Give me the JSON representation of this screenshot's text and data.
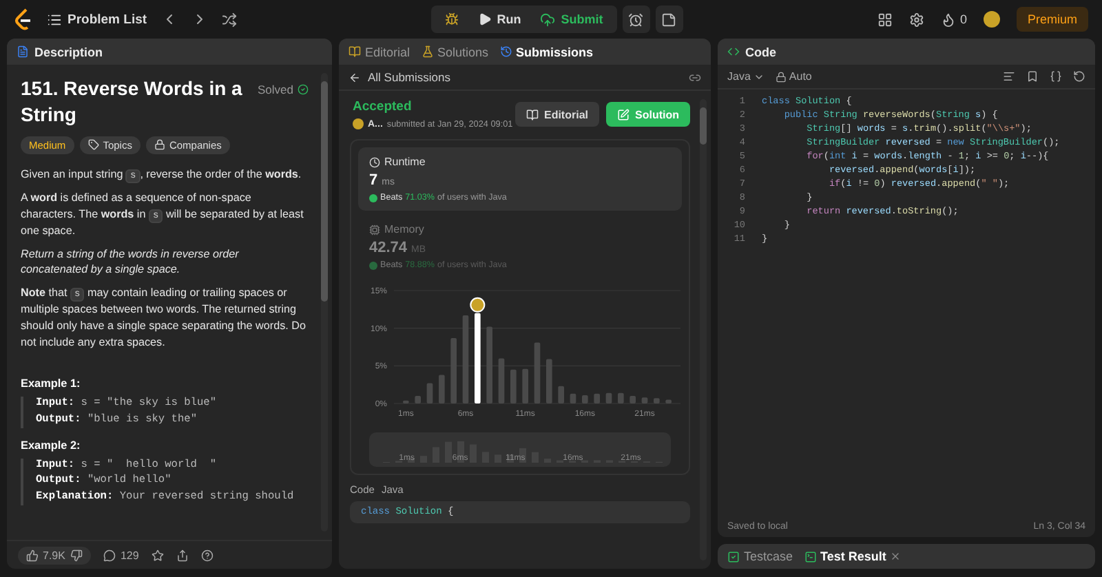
{
  "top_bar": {
    "problem_list": "Problem List",
    "run": "Run",
    "submit": "Submit",
    "streak": "0",
    "premium": "Premium"
  },
  "description_panel": {
    "tab": "Description",
    "title": "151. Reverse Words in a String",
    "status": "Solved",
    "tags": [
      {
        "label": "Medium",
        "kind": "difficulty"
      },
      {
        "label": "Topics",
        "kind": "topics"
      },
      {
        "label": "Companies",
        "kind": "companies"
      }
    ],
    "paragraphs": [
      [
        {
          "text": "Given an input string ",
          "kind": "text"
        },
        {
          "text": "s",
          "kind": "code"
        },
        {
          "text": ", reverse the order of the **words**.",
          "kind": "text"
        }
      ],
      [
        {
          "text": "A **word** is defined as a sequence of non-space characters. The **words** in ",
          "kind": "text"
        },
        {
          "text": "s",
          "kind": "code"
        },
        {
          "text": " will be separated by at least one space.",
          "kind": "text"
        }
      ],
      [
        {
          "text": "*Return* *a string of the words in reverse order concatenated by a single space.*",
          "kind": "text"
        }
      ],
      [
        {
          "text": "**Note** that ",
          "kind": "text"
        },
        {
          "text": "s",
          "kind": "code"
        },
        {
          "text": " may contain leading or trailing spaces or multiple spaces between two words. The returned string should only have a single space separating the words. Do not include any extra spaces.",
          "kind": "text"
        }
      ]
    ],
    "examples": [
      {
        "title": "Example 1:",
        "lines": [
          {
            "label": "Input:",
            "value": "s = \"the sky is blue\""
          },
          {
            "label": "Output:",
            "value": "\"blue is sky the\""
          }
        ]
      },
      {
        "title": "Example 2:",
        "lines": [
          {
            "label": "Input:",
            "value": "s = \"  hello world  \""
          },
          {
            "label": "Output:",
            "value": "\"world hello\""
          },
          {
            "label": "Explanation:",
            "value": "Your reversed string should"
          }
        ]
      }
    ],
    "likes": "7.9K",
    "comments": "129"
  },
  "submissions_panel": {
    "tabs": [
      {
        "label": "Editorial",
        "selected": false
      },
      {
        "label": "Solutions",
        "selected": false
      },
      {
        "label": "Submissions",
        "selected": true
      }
    ],
    "back_label": "All Submissions",
    "status": "Accepted",
    "user": "A...",
    "submitted": "submitted at Jan 29, 2024 09:01",
    "buttons": [
      {
        "label": "Editorial",
        "kind": "secondary"
      },
      {
        "label": "Solution",
        "kind": "primary"
      }
    ],
    "metrics": [
      {
        "kind": "runtime",
        "title": "Runtime",
        "value": "7",
        "unit": "ms",
        "beats_label": "Beats",
        "beats": "71.03%",
        "beats_suffix": "of users with Java",
        "selected": true
      },
      {
        "kind": "memory",
        "title": "Memory",
        "value": "42.74",
        "unit": "MB",
        "beats_label": "Beats",
        "beats": "78.88%",
        "beats_suffix": "of users with Java",
        "selected": false
      }
    ],
    "chart_data": {
      "type": "bar",
      "x": [
        1,
        2,
        3,
        4,
        5,
        6,
        7,
        8,
        9,
        10,
        11,
        12,
        13,
        14,
        15,
        16,
        17,
        18,
        19,
        20,
        21,
        22,
        23
      ],
      "series": [
        {
          "color": "#4a4a4a",
          "values": [
            0.4,
            1.0,
            2.7,
            3.8,
            8.7,
            11.7,
            null,
            10.2,
            6.0,
            4.5,
            4.6,
            8.1,
            5.9,
            2.3,
            1.3,
            1.1,
            1.3,
            1.4,
            1.4,
            1.0,
            0.8,
            0.7,
            0.5
          ]
        },
        {
          "color": "#ffffff",
          "values": [
            null,
            null,
            null,
            null,
            null,
            null,
            12.0,
            null,
            null,
            null,
            null,
            null,
            null,
            null,
            null,
            null,
            null,
            null,
            null,
            null,
            null,
            null,
            null
          ]
        }
      ],
      "xlim": [
        0,
        24
      ],
      "ylim": [
        0,
        15
      ],
      "xticks": [
        {
          "value": 1,
          "label": "1ms"
        },
        {
          "value": 6,
          "label": "6ms"
        },
        {
          "value": 11,
          "label": "11ms"
        },
        {
          "value": 16,
          "label": "16ms"
        },
        {
          "value": 21,
          "label": "21ms"
        }
      ],
      "yticks": [
        {
          "value": 0,
          "label": "0%"
        },
        {
          "value": 5,
          "label": "5%"
        },
        {
          "value": 10,
          "label": "10%"
        },
        {
          "value": 15,
          "label": "15%"
        }
      ]
    },
    "navigator": {
      "labels": [
        "1ms",
        "6ms",
        "11ms",
        "16ms",
        "21ms"
      ]
    },
    "code_label": "Code",
    "code_language": "Java",
    "code_preview": [
      {
        "text": "class ",
        "kind": "kw"
      },
      {
        "text": "Solution ",
        "kind": "type"
      },
      {
        "text": "{",
        "kind": "plain"
      }
    ]
  },
  "code_panel": {
    "title": "Code",
    "language": "Java",
    "mode": "Auto",
    "lines": [
      {
        "n": "1",
        "tokens": [
          {
            "text": "class ",
            "kind": "kw"
          },
          {
            "text": "Solution ",
            "kind": "type"
          },
          {
            "text": "{",
            "kind": "plain"
          }
        ]
      },
      {
        "n": "2",
        "tokens": [
          {
            "text": "    public ",
            "kind": "kw"
          },
          {
            "text": "String ",
            "kind": "type"
          },
          {
            "text": "reverseWords",
            "kind": "fn"
          },
          {
            "text": "(",
            "kind": "plain"
          },
          {
            "text": "String ",
            "kind": "type"
          },
          {
            "text": "s",
            "kind": "var"
          },
          {
            "text": ") {",
            "kind": "plain"
          }
        ]
      },
      {
        "n": "3",
        "tokens": [
          {
            "text": "        String",
            "kind": "type"
          },
          {
            "text": "[] ",
            "kind": "plain"
          },
          {
            "text": "words",
            "kind": "var"
          },
          {
            "text": " = ",
            "kind": "plain"
          },
          {
            "text": "s",
            "kind": "var"
          },
          {
            "text": ".",
            "kind": "plain"
          },
          {
            "text": "trim",
            "kind": "fn"
          },
          {
            "text": "().",
            "kind": "plain"
          },
          {
            "text": "split",
            "kind": "fn"
          },
          {
            "text": "(",
            "kind": "plain"
          },
          {
            "text": "\"\\\\s+\"",
            "kind": "str"
          },
          {
            "text": ");",
            "kind": "plain"
          }
        ]
      },
      {
        "n": "4",
        "tokens": [
          {
            "text": "        StringBuilder ",
            "kind": "type"
          },
          {
            "text": "reversed",
            "kind": "var"
          },
          {
            "text": " = ",
            "kind": "plain"
          },
          {
            "text": "new ",
            "kind": "kw"
          },
          {
            "text": "StringBuilder",
            "kind": "type"
          },
          {
            "text": "();",
            "kind": "plain"
          }
        ]
      },
      {
        "n": "5",
        "tokens": [
          {
            "text": "        for",
            "kind": "ctrl"
          },
          {
            "text": "(",
            "kind": "plain"
          },
          {
            "text": "int ",
            "kind": "kw"
          },
          {
            "text": "i",
            "kind": "var"
          },
          {
            "text": " = ",
            "kind": "plain"
          },
          {
            "text": "words",
            "kind": "var"
          },
          {
            "text": ".",
            "kind": "plain"
          },
          {
            "text": "length",
            "kind": "var"
          },
          {
            "text": " - ",
            "kind": "plain"
          },
          {
            "text": "1",
            "kind": "num"
          },
          {
            "text": "; ",
            "kind": "plain"
          },
          {
            "text": "i",
            "kind": "var"
          },
          {
            "text": " >= ",
            "kind": "plain"
          },
          {
            "text": "0",
            "kind": "num"
          },
          {
            "text": "; ",
            "kind": "plain"
          },
          {
            "text": "i",
            "kind": "var"
          },
          {
            "text": "--){",
            "kind": "plain"
          }
        ]
      },
      {
        "n": "6",
        "tokens": [
          {
            "text": "            reversed",
            "kind": "var"
          },
          {
            "text": ".",
            "kind": "plain"
          },
          {
            "text": "append",
            "kind": "fn"
          },
          {
            "text": "(",
            "kind": "plain"
          },
          {
            "text": "words",
            "kind": "var"
          },
          {
            "text": "[",
            "kind": "plain"
          },
          {
            "text": "i",
            "kind": "var"
          },
          {
            "text": "]);",
            "kind": "plain"
          }
        ]
      },
      {
        "n": "7",
        "tokens": [
          {
            "text": "            if",
            "kind": "ctrl"
          },
          {
            "text": "(",
            "kind": "plain"
          },
          {
            "text": "i",
            "kind": "var"
          },
          {
            "text": " != ",
            "kind": "plain"
          },
          {
            "text": "0",
            "kind": "num"
          },
          {
            "text": ") ",
            "kind": "plain"
          },
          {
            "text": "reversed",
            "kind": "var"
          },
          {
            "text": ".",
            "kind": "plain"
          },
          {
            "text": "append",
            "kind": "fn"
          },
          {
            "text": "(",
            "kind": "plain"
          },
          {
            "text": "\" \"",
            "kind": "str"
          },
          {
            "text": ");",
            "kind": "plain"
          }
        ]
      },
      {
        "n": "8",
        "tokens": [
          {
            "text": "        }",
            "kind": "plain"
          }
        ]
      },
      {
        "n": "9",
        "tokens": [
          {
            "text": "        return ",
            "kind": "ctrl"
          },
          {
            "text": "reversed",
            "kind": "var"
          },
          {
            "text": ".",
            "kind": "plain"
          },
          {
            "text": "toString",
            "kind": "fn"
          },
          {
            "text": "();",
            "kind": "plain"
          }
        ]
      },
      {
        "n": "10",
        "tokens": [
          {
            "text": "    }",
            "kind": "plain"
          }
        ]
      },
      {
        "n": "11",
        "tokens": [
          {
            "text": "}",
            "kind": "plain"
          }
        ]
      }
    ],
    "saved": "Saved to local",
    "cursor": "Ln 3, Col 34"
  },
  "console": {
    "tabs": [
      {
        "label": "Testcase",
        "selected": false
      },
      {
        "label": "Test Result",
        "selected": true
      }
    ]
  }
}
